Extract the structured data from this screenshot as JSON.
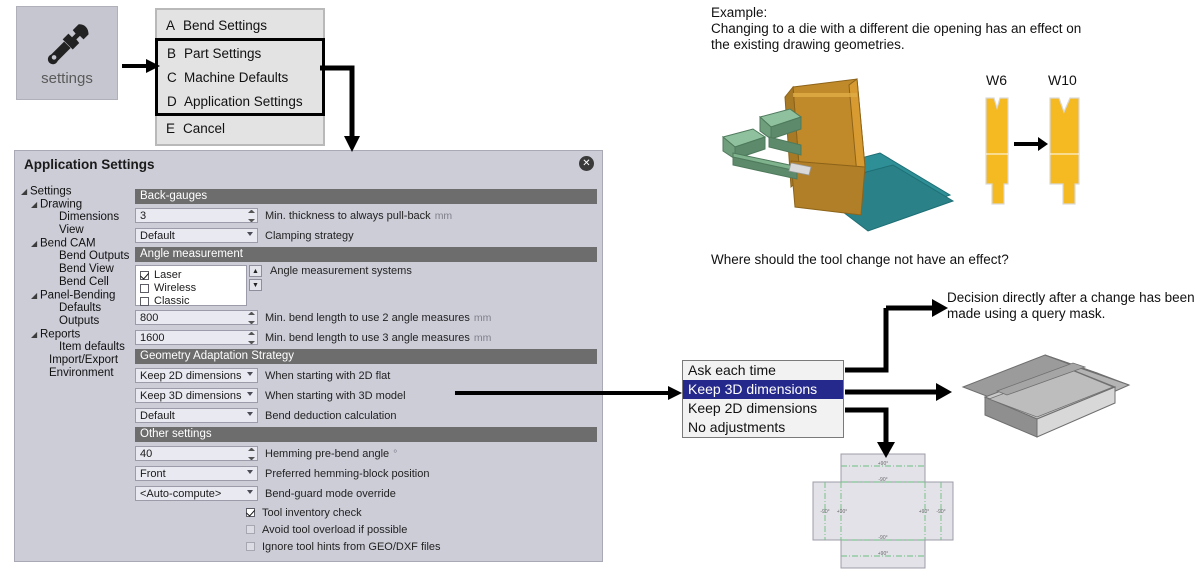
{
  "settings_tile": {
    "label": "settings",
    "icon": "wrench-icon"
  },
  "menu": {
    "items": [
      {
        "key": "A",
        "label": "Bend Settings",
        "highlighted": false
      },
      {
        "key": "B",
        "label": "Part Settings",
        "highlighted": true
      },
      {
        "key": "C",
        "label": "Machine Defaults",
        "highlighted": true
      },
      {
        "key": "D",
        "label": "Application Settings",
        "highlighted": true
      },
      {
        "key": "E",
        "label": "Cancel",
        "highlighted": false
      }
    ]
  },
  "dialog": {
    "title": "Application Settings",
    "close_label": "✕",
    "tree": [
      {
        "label": "Settings",
        "level": 0,
        "twisty": true
      },
      {
        "label": "Drawing",
        "level": 1,
        "twisty": true
      },
      {
        "label": "Dimensions",
        "level": 2,
        "twisty": false
      },
      {
        "label": "View",
        "level": 2,
        "twisty": false
      },
      {
        "label": "Bend CAM",
        "level": 1,
        "twisty": true
      },
      {
        "label": "Bend Outputs",
        "level": 2,
        "twisty": false
      },
      {
        "label": "Bend View",
        "level": 2,
        "twisty": false
      },
      {
        "label": "Bend Cell",
        "level": 2,
        "twisty": false
      },
      {
        "label": "Panel-Bending",
        "level": 1,
        "twisty": true
      },
      {
        "label": "Defaults",
        "level": 2,
        "twisty": false
      },
      {
        "label": "Outputs",
        "level": 2,
        "twisty": false
      },
      {
        "label": "Reports",
        "level": 1,
        "twisty": true
      },
      {
        "label": "Item defaults",
        "level": 2,
        "twisty": false
      },
      {
        "label": "Import/Export",
        "level": 1,
        "twisty": false
      },
      {
        "label": "Environment",
        "level": 1,
        "twisty": false
      }
    ],
    "sections": [
      {
        "header": "Back-gauges",
        "rows": [
          {
            "kind": "spinner",
            "value": "3",
            "label": "Min. thickness to always pull-back",
            "unit": "mm"
          },
          {
            "kind": "combo",
            "value": "Default",
            "label": "Clamping strategy",
            "unit": ""
          }
        ]
      },
      {
        "header": "Angle measurement",
        "checkbox_list": {
          "note": "Angle measurement systems",
          "items": [
            {
              "label": "Laser",
              "checked": true
            },
            {
              "label": "Wireless",
              "checked": false
            },
            {
              "label": "Classic",
              "checked": false
            }
          ],
          "scroll_up": "▲",
          "scroll_down": "▼"
        },
        "rows": [
          {
            "kind": "spinner",
            "value": "800",
            "label": "Min. bend length to use 2 angle measures",
            "unit": "mm"
          },
          {
            "kind": "spinner",
            "value": "1600",
            "label": "Min. bend length to use 3 angle measures",
            "unit": "mm"
          }
        ]
      },
      {
        "header": "Geometry Adaptation Strategy",
        "rows": [
          {
            "kind": "combo",
            "value": "Keep 2D dimensions",
            "label": "When starting with 2D flat",
            "unit": ""
          },
          {
            "kind": "combo",
            "value": "Keep 3D dimensions",
            "label": "When starting with 3D model",
            "unit": ""
          },
          {
            "kind": "combo",
            "value": "Default",
            "label": "Bend deduction calculation",
            "unit": ""
          }
        ]
      },
      {
        "header": "Other settings",
        "rows": [
          {
            "kind": "spinner",
            "value": "40",
            "label": "Hemming pre-bend angle",
            "unit": "°"
          },
          {
            "kind": "combo",
            "value": "Front",
            "label": "Preferred hemming-block position",
            "unit": ""
          },
          {
            "kind": "combo",
            "value": "<Auto-compute>",
            "label": "Bend-guard mode override",
            "unit": ""
          }
        ],
        "checks": [
          {
            "label": "Tool inventory check",
            "checked": true
          },
          {
            "label": "Avoid tool overload if possible",
            "checked": false
          },
          {
            "label": "Ignore tool hints from GEO/DXF files",
            "checked": false
          }
        ]
      }
    ]
  },
  "annotations": {
    "example_heading": "Example:",
    "example_body": "Changing to a die with a different die opening has an effect on the existing drawing geometries.",
    "question": "Where should the tool change not have an effect?",
    "decision": "Decision directly after a change has been made using a query mask."
  },
  "dies": {
    "left_label": "W6",
    "right_label": "W10"
  },
  "dropdown": {
    "options": [
      {
        "label": "Ask each time",
        "selected": false
      },
      {
        "label": "Keep 3D dimensions",
        "selected": true
      },
      {
        "label": "Keep 2D dimensions",
        "selected": false
      },
      {
        "label": "No adjustments",
        "selected": false
      }
    ]
  },
  "flat_pattern": {
    "angle_labels": [
      "-90°",
      "+90°",
      "+90°",
      "-90°",
      "-90°",
      "+90°",
      "+90°",
      "-90°"
    ]
  },
  "colors": {
    "die_fill": "#f5b921",
    "accent_selection": "#26298c",
    "section_header_bg": "#6d6d6d",
    "dialog_bg": "#cdcdd8",
    "press_brake": "#c08a2a",
    "sheet_teal": "#2f8f96",
    "backgauge_green": "#6f9e7d"
  }
}
